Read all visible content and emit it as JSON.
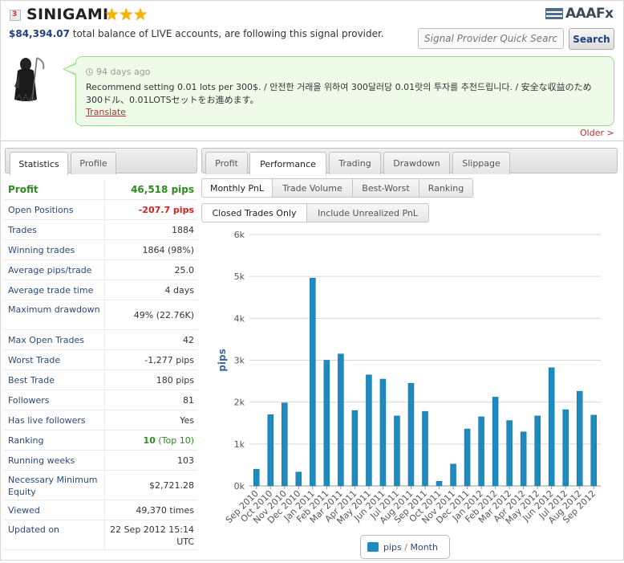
{
  "provider": {
    "name": "SINIGAMI",
    "stars": "★★★",
    "balance_amount": "$84,394.07",
    "balance_text": " total balance of LIVE accounts, are following this signal provider."
  },
  "brand": {
    "name": "AAAFx"
  },
  "search": {
    "placeholder": "Signal Provider Quick Search",
    "button_label": "Search"
  },
  "message": {
    "time": "94 days ago",
    "text": "Recommend setting 0.01 lots per 300$. / 안전한 거래을 위하여 300달러당 0.01랏의 투자를 추천드립니다. / 安全な収益のため300ドル、0.01LOTSセットをお進めます。",
    "translate_label": "Translate",
    "older_label": "Older >"
  },
  "left_tabs": [
    {
      "label": "Statistics",
      "active": true
    },
    {
      "label": "Profile",
      "active": false
    }
  ],
  "right_tabs": [
    {
      "label": "Profit",
      "active": false
    },
    {
      "label": "Performance",
      "active": true
    },
    {
      "label": "Trading",
      "active": false
    },
    {
      "label": "Drawdown",
      "active": false
    },
    {
      "label": "Slippage",
      "active": false
    }
  ],
  "sub_tabs": [
    {
      "label": "Monthly PnL",
      "active": true
    },
    {
      "label": "Trade Volume",
      "active": false
    },
    {
      "label": "Best-Worst",
      "active": false
    },
    {
      "label": "Ranking",
      "active": false
    }
  ],
  "filter_tabs": [
    {
      "label": "Closed Trades Only",
      "active": true
    },
    {
      "label": "Include Unrealized PnL",
      "active": false
    }
  ],
  "stats": [
    {
      "label": "Profit",
      "value": "46,518 pips",
      "style": "profit"
    },
    {
      "label": "Open Positions",
      "value": "-207.7 pips",
      "style": "red"
    },
    {
      "label": "Trades",
      "value": "1884"
    },
    {
      "label": "Winning trades",
      "value": "1864 (98%)"
    },
    {
      "label": "Average pips/trade",
      "value": "25.0"
    },
    {
      "label": "Average trade time",
      "value": "4 days"
    },
    {
      "label": "Maximum drawdown",
      "value": "49% (22.76K)",
      "tall": true
    },
    {
      "label": "Max Open Trades",
      "value": "42"
    },
    {
      "label": "Worst Trade",
      "value": "-1,277 pips"
    },
    {
      "label": "Best Trade",
      "value": "180 pips"
    },
    {
      "label": "Followers",
      "value": "81"
    },
    {
      "label": "Has live followers",
      "value": "Yes"
    },
    {
      "label": "Ranking",
      "value": "10",
      "value_suffix": " (Top 10)",
      "style": "green"
    },
    {
      "label": "Running weeks",
      "value": "103"
    },
    {
      "label": "Necessary Minimum Equity",
      "value": "$2,721.28",
      "tall": true
    },
    {
      "label": "Viewed",
      "value": "49,370 times"
    },
    {
      "label": "Updated on",
      "value": "22 Sep 2012 15:14 UTC",
      "tall": true
    }
  ],
  "chart_data": {
    "type": "bar",
    "ylabel": "pips",
    "ylim": [
      0,
      6000
    ],
    "yticks": [
      "0k",
      "1k",
      "2k",
      "3k",
      "4k",
      "5k",
      "6k"
    ],
    "categories": [
      "Sep 2010",
      "Oct 2010",
      "Nov 2010",
      "Dec 2010",
      "Jan 2011",
      "Feb 2011",
      "Mar 2011",
      "Apr 2011",
      "May 2011",
      "Jun 2011",
      "Jul 2011",
      "Aug 2011",
      "Sep 2011",
      "Oct 2011",
      "Nov 2011",
      "Dec 2011",
      "Jan 2012",
      "Feb 2012",
      "Mar 2012",
      "Apr 2012",
      "May 2012",
      "Jun 2012",
      "Jul 2012",
      "Aug 2012",
      "Sep 2012"
    ],
    "series": [
      {
        "name": "pips",
        "color": "#1d8ac0",
        "values": [
          400,
          1700,
          1980,
          330,
          4960,
          3000,
          3150,
          1800,
          2650,
          2550,
          1670,
          2450,
          1780,
          110,
          520,
          1360,
          1650,
          2120,
          1560,
          1290,
          1670,
          2820,
          1820,
          2260,
          1690
        ]
      }
    ],
    "legend": {
      "series_label": "pips",
      "separator": " / ",
      "period_label": "Month",
      "position": "bottom-center"
    }
  }
}
